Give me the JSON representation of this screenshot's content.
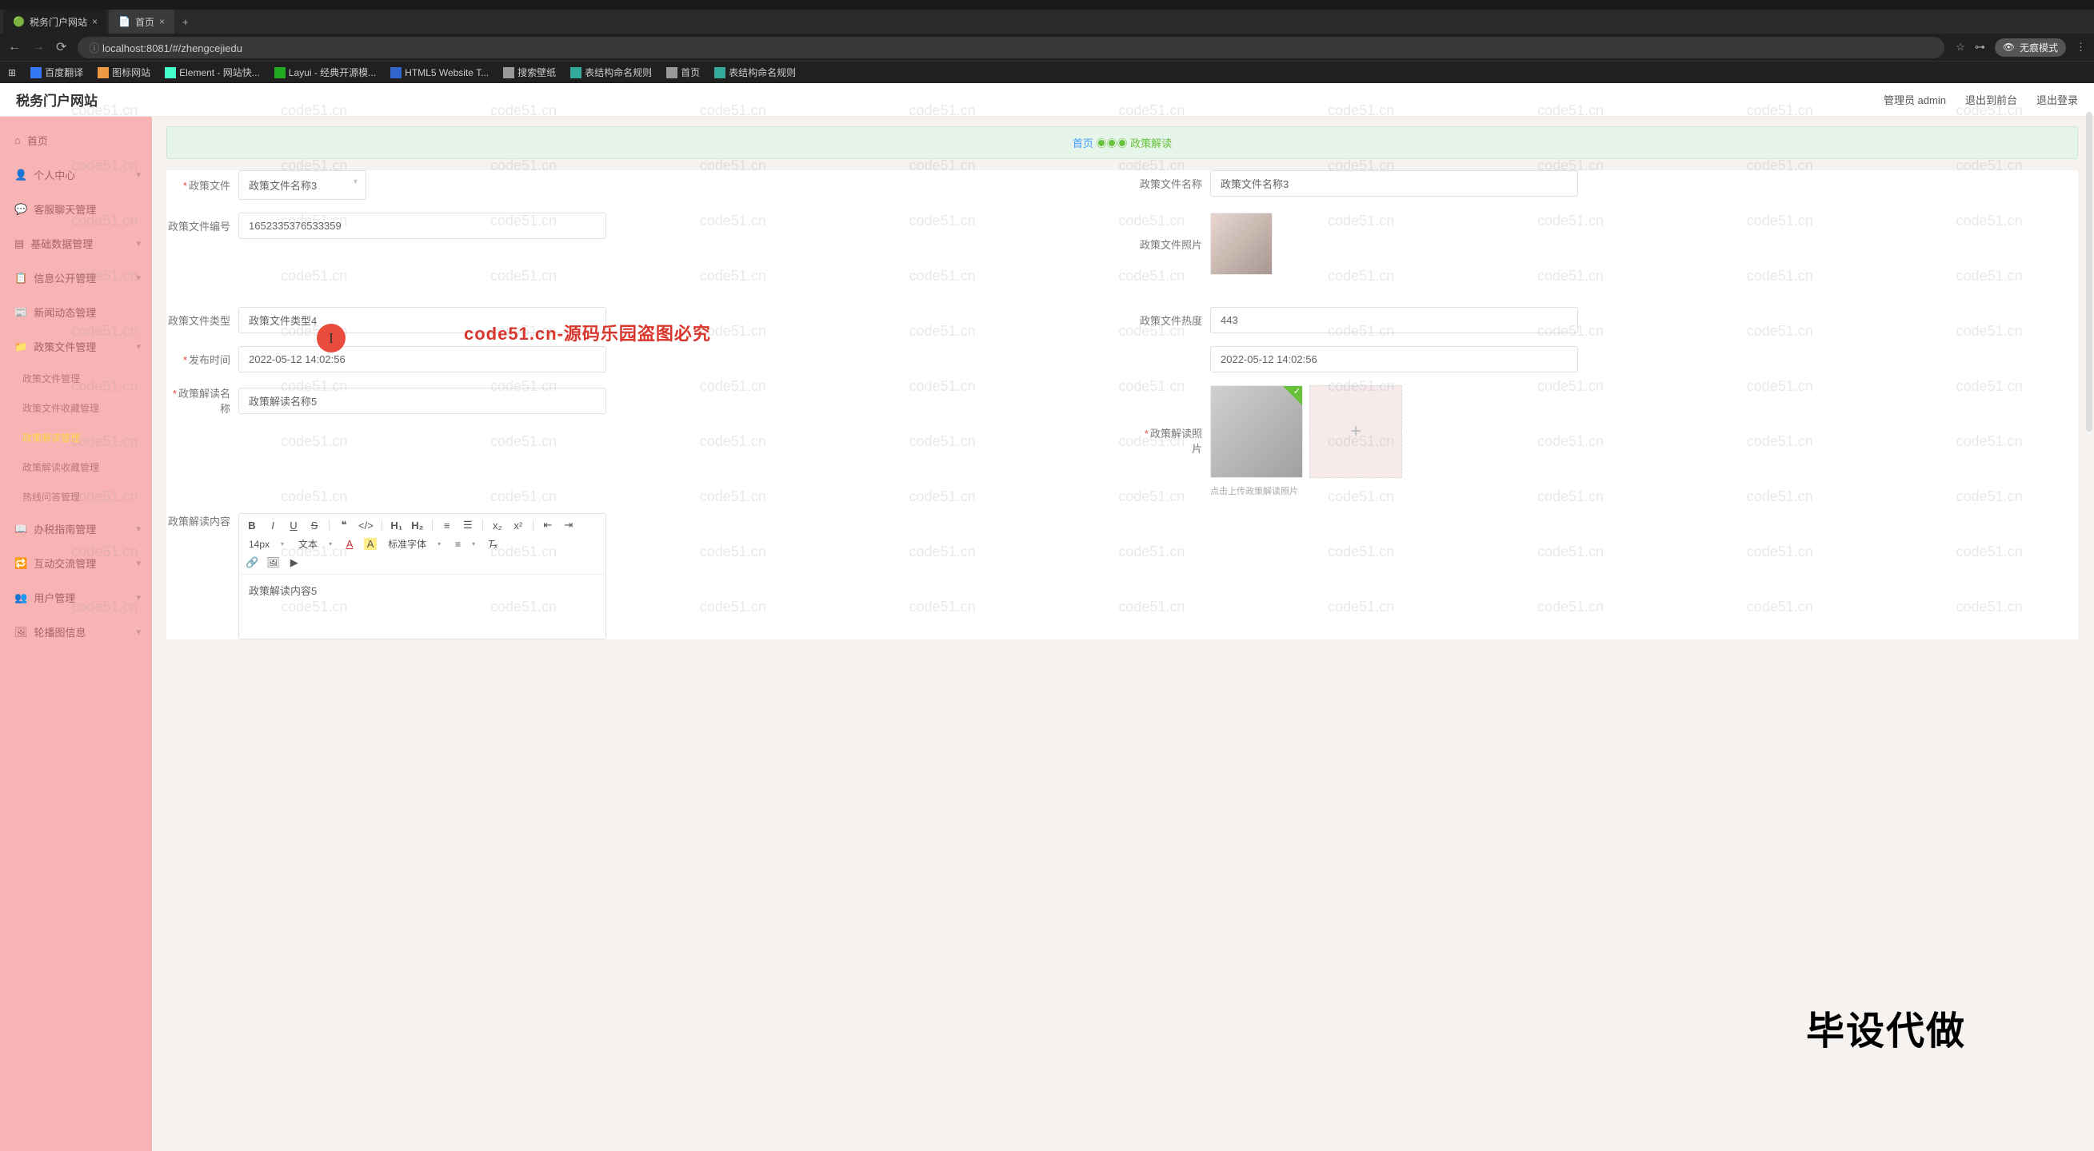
{
  "browser": {
    "tabs": [
      {
        "title": "税务门户网站"
      },
      {
        "title": "首页"
      }
    ],
    "url": "localhost:8081/#/zhengcejiedu",
    "incognito": "无痕模式"
  },
  "bookmarks": [
    "百度翻译",
    "图标网站",
    "Element - 网站快...",
    "Layui - 经典开源模...",
    "HTML5 Website T...",
    "搜索壁纸",
    "表结构命名规则",
    "首页",
    "表结构命名规则"
  ],
  "header": {
    "logo": "税务门户网站",
    "user": "管理员 admin",
    "logout_front": "退出到前台",
    "logout": "退出登录"
  },
  "breadcrumb": {
    "home": "首页",
    "current": "政策解读"
  },
  "sidebar": [
    {
      "label": "首页",
      "icon": "home"
    },
    {
      "label": "个人中心",
      "icon": "user",
      "has_sub": true
    },
    {
      "label": "客服聊天管理",
      "icon": "chat"
    },
    {
      "label": "基础数据管理",
      "icon": "data",
      "has_sub": true
    },
    {
      "label": "信息公开管理",
      "icon": "info",
      "has_sub": true
    },
    {
      "label": "新闻动态管理",
      "icon": "news"
    },
    {
      "label": "政策文件管理",
      "icon": "file",
      "has_sub": true,
      "children": [
        {
          "label": "政策文件管理"
        },
        {
          "label": "政策文件收藏管理"
        },
        {
          "label": "政策解读管理",
          "active": true
        },
        {
          "label": "政策解读收藏管理"
        },
        {
          "label": "热线问答管理"
        }
      ]
    },
    {
      "label": "办税指南管理",
      "icon": "guide",
      "has_sub": true
    },
    {
      "label": "互动交流管理",
      "icon": "interact",
      "has_sub": true
    },
    {
      "label": "用户管理",
      "icon": "users",
      "has_sub": true
    },
    {
      "label": "轮播图信息",
      "icon": "carousel",
      "has_sub": true
    }
  ],
  "form": {
    "policy_file_label": "政策文件",
    "policy_file_value": "政策文件名称3",
    "policy_file_name_label": "政策文件名称",
    "policy_file_name_value": "政策文件名称3",
    "policy_file_code_label": "政策文件编号",
    "policy_file_code_value": "1652335376533359",
    "policy_file_photo_label": "政策文件照片",
    "policy_file_type_label": "政策文件类型",
    "policy_file_type_value": "政策文件类型4",
    "policy_file_heat_label": "政策文件热度",
    "policy_file_heat_value": "443",
    "publish_time_label": "发布时间",
    "publish_time_value": "2022-05-12 14:02:56",
    "publish_time_2_value": "2022-05-12 14:02:56",
    "interpret_name_label": "政策解读名称",
    "interpret_name_value": "政策解读名称5",
    "interpret_photo_label": "政策解读照片",
    "interpret_photo_hint": "点击上传政策解读照片",
    "interpret_content_label": "政策解读内容",
    "interpret_content_value": "政策解读内容5"
  },
  "editor": {
    "font_size": "14px",
    "text_type": "文本",
    "font_family": "标准字体"
  },
  "watermark": {
    "text": "code51.cn",
    "red": "code51.cn-源码乐园盗图必究",
    "big": "毕设代做"
  }
}
